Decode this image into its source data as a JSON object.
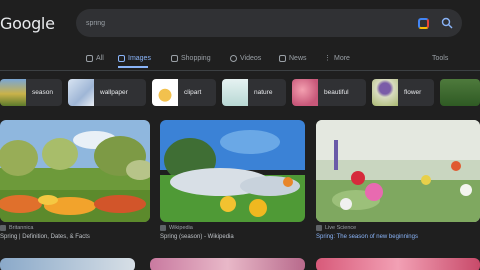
{
  "logo": "Google",
  "search": {
    "query": "spring"
  },
  "tabs": [
    {
      "label": "All",
      "icon": "all-icon"
    },
    {
      "label": "Images",
      "icon": "image-icon",
      "active": true
    },
    {
      "label": "Shopping",
      "icon": "shopping-icon"
    },
    {
      "label": "Videos",
      "icon": "video-icon"
    },
    {
      "label": "News",
      "icon": "news-icon"
    },
    {
      "label": "More",
      "icon": "more-icon"
    }
  ],
  "tools_label": "Tools",
  "chips": [
    {
      "label": "season"
    },
    {
      "label": "wallpaper"
    },
    {
      "label": "clipart"
    },
    {
      "label": "nature"
    },
    {
      "label": "beautiful"
    },
    {
      "label": "flower"
    }
  ],
  "results": [
    {
      "source": "Britannica",
      "caption": "Spring | Definition, Dates, & Facts"
    },
    {
      "source": "Wikipedia",
      "caption": "Spring (season) - Wikipedia"
    },
    {
      "source": "Live Science",
      "caption": "Spring: The season of new beginnings"
    }
  ],
  "colors": {
    "background": "#1f1f1f",
    "accent": "#8ab4f8",
    "surface": "#303134"
  }
}
